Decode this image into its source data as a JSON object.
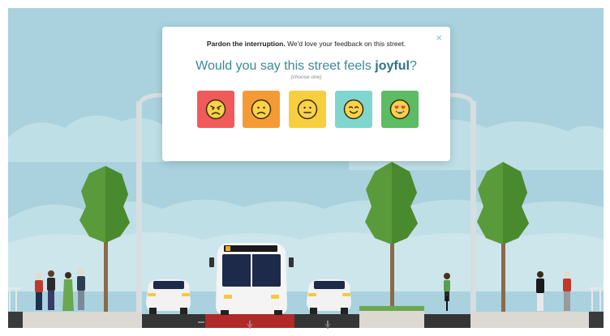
{
  "survey": {
    "intro_bold": "Pardon the interruption.",
    "intro_rest": " We'd love your feedback on this street.",
    "question_pre": "Would you say this street feels ",
    "question_word": "joyful",
    "question_post": "?",
    "hint": "(choose one)",
    "close_symbol": "×",
    "choices": [
      {
        "icon": "angry-face-icon",
        "color": "#f05a5b"
      },
      {
        "icon": "sad-face-icon",
        "color": "#f59b36"
      },
      {
        "icon": "neutral-face-icon",
        "color": "#f7cf3e"
      },
      {
        "icon": "smiling-face-icon",
        "color": "#7fd6cf"
      },
      {
        "icon": "heart-eyes-face-icon",
        "color": "#5dbb63"
      }
    ]
  },
  "colors": {
    "sky": "#a9d2de",
    "clouds": "#bfdfe7",
    "teal_accent": "#3a8a94",
    "bus_lane": "#b02a2a",
    "asphalt": "#353535",
    "sidewalk": "#dcd8d2",
    "tree_foliage": "#5a9a3a"
  }
}
